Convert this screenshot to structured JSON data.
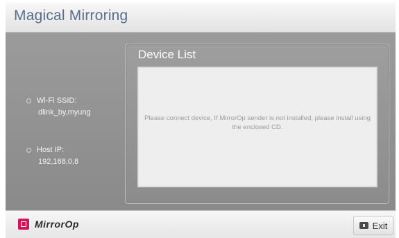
{
  "app": {
    "title": "Magical Mirroring"
  },
  "info": {
    "ssid_label": "Wi-Fi SSID:",
    "ssid_value": "dlink_by,myung",
    "host_ip_label": "Host IP:",
    "host_ip_value": "192,168,0,8"
  },
  "device_list": {
    "title": "Device List",
    "message": "Please connect device, If MirrorOp sender is not installed, please install using the enclosed CD."
  },
  "footer": {
    "logo_text": "MirrorOp",
    "logo_icon": "mirrorop-logo-icon",
    "exit_label": "Exit",
    "exit_icon": "exit-key-icon"
  },
  "colors": {
    "title_text": "#5a6e8c",
    "logo_accent": "#d4145a",
    "background": "#8e8e8e"
  }
}
